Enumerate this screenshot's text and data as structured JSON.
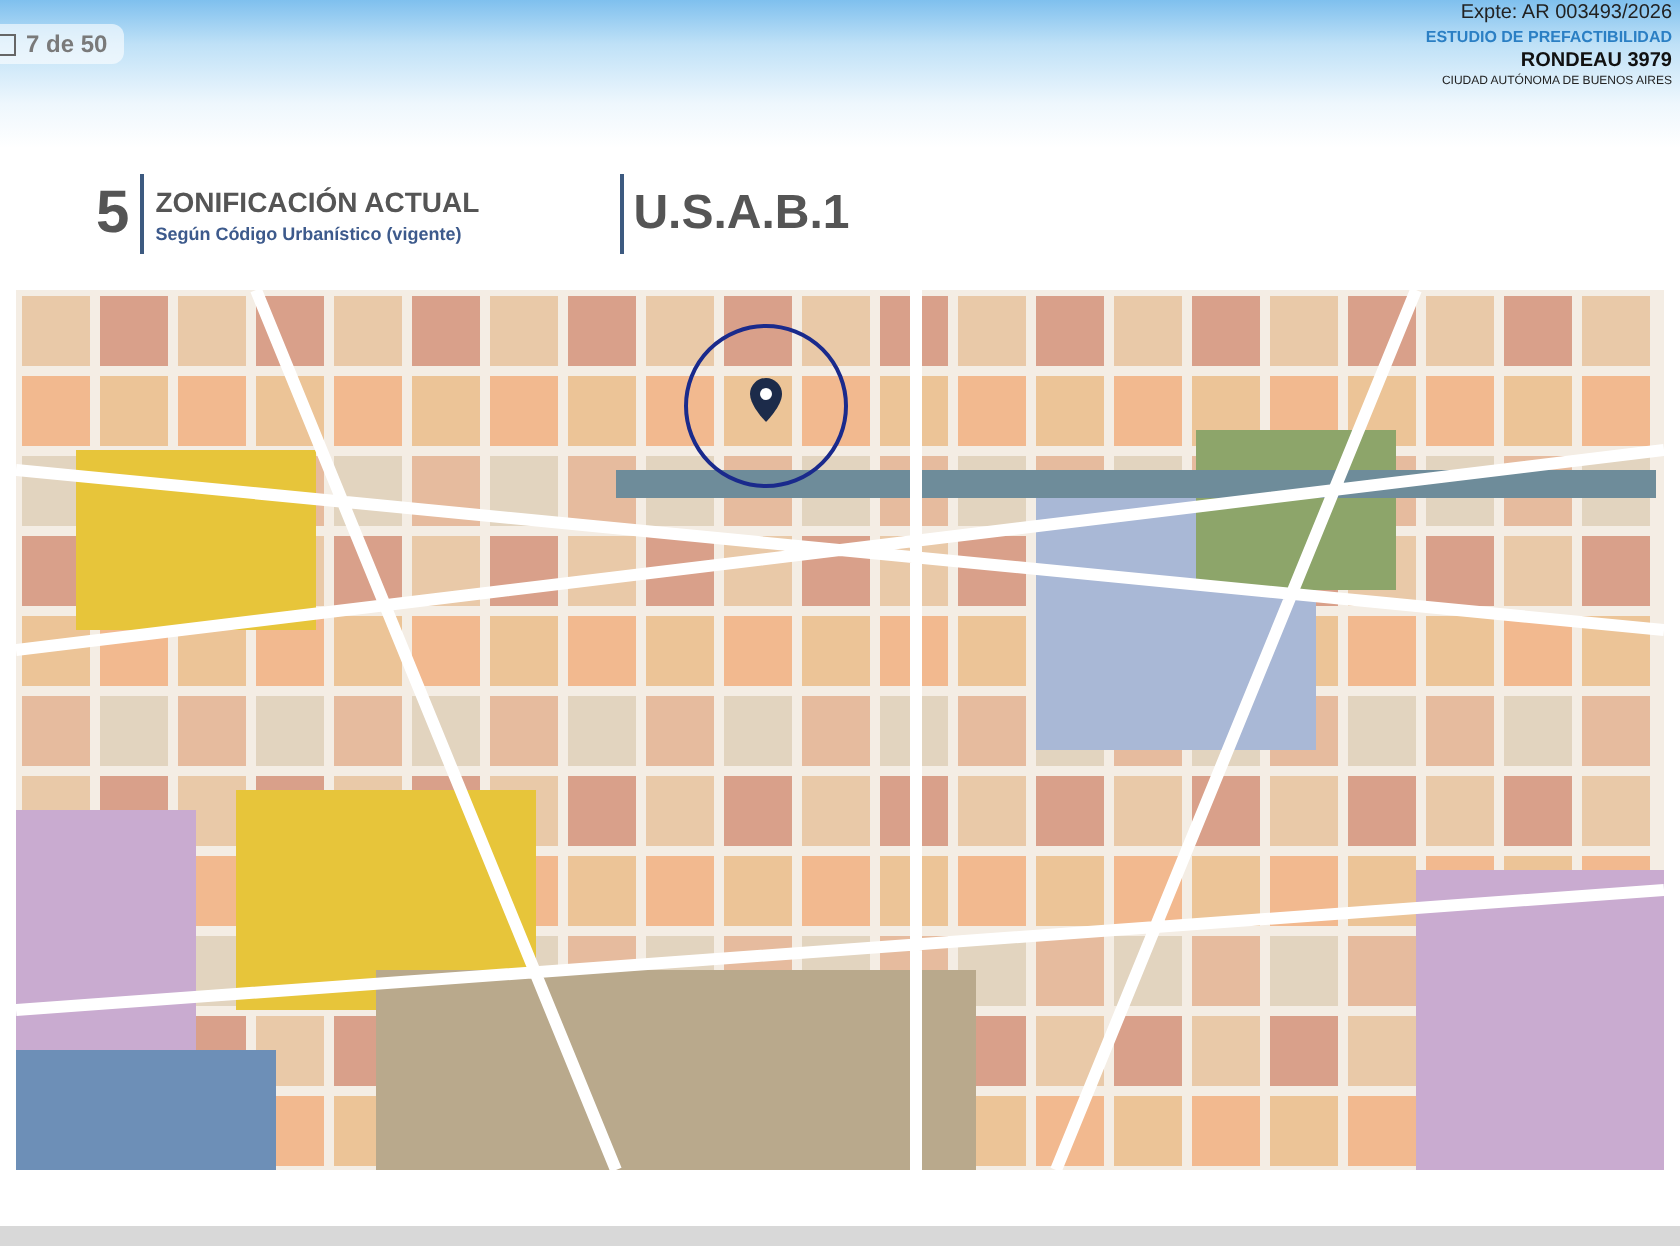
{
  "page_counter": {
    "label": "7 de 50"
  },
  "header": {
    "file_number": "Expte: AR 003493/2026",
    "study": "ESTUDIO DE PREFACTIBILIDAD",
    "address": "RONDEAU 3979",
    "city": "CIUDAD AUTÓNOMA DE BUENOS AIRES"
  },
  "section": {
    "number": "5",
    "title": "ZONIFICACIÓN ACTUAL",
    "subtitle": "Según Código Urbanístico (vigente)",
    "zone_code": "U.S.A.B.1"
  }
}
